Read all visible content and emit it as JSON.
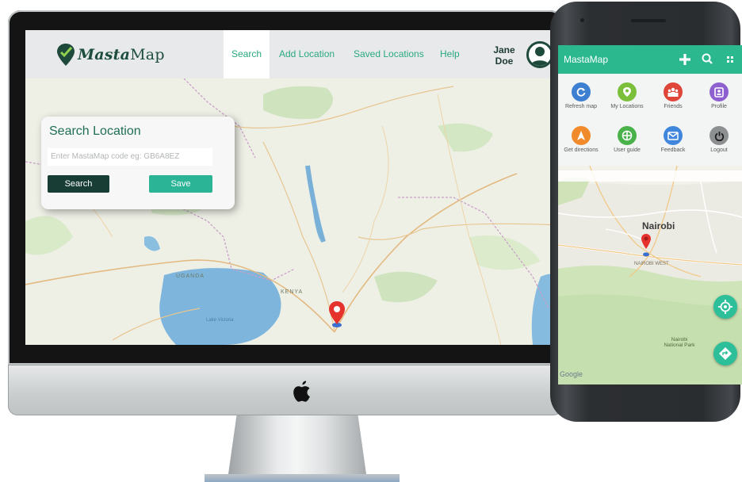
{
  "website": {
    "brand": {
      "prefix": "Masta",
      "suffix": "Map"
    },
    "nav": [
      {
        "label": "Search",
        "active": true
      },
      {
        "label": "Add Location",
        "active": false
      },
      {
        "label": "Saved Locations",
        "active": false
      },
      {
        "label": "Help",
        "active": false
      }
    ],
    "user": {
      "first": "Jane",
      "last": "Doe"
    },
    "search_panel": {
      "title": "Search Location",
      "placeholder": "Enter MastaMap code eg: GB6A8EZ",
      "search_button": "Search",
      "save_button": "Save"
    },
    "map_labels": [
      "UGANDA",
      "KENYA",
      "Lake Victoria"
    ]
  },
  "phone": {
    "app_title": "MastaMap",
    "menu": [
      {
        "label": "Refresh map",
        "icon": "refresh-icon",
        "color": "#3d7fd1"
      },
      {
        "label": "My Locations",
        "icon": "location-pin-icon",
        "color": "#7cbf3b"
      },
      {
        "label": "Friends",
        "icon": "friends-icon",
        "color": "#e0453a"
      },
      {
        "label": "Profile",
        "icon": "profile-icon",
        "color": "#8e5fcf"
      },
      {
        "label": "Get directions",
        "icon": "directions-icon",
        "color": "#f08a2a"
      },
      {
        "label": "User guide",
        "icon": "user-guide-icon",
        "color": "#49b24a"
      },
      {
        "label": "Feedback",
        "icon": "feedback-icon",
        "color": "#3f86dc"
      },
      {
        "label": "Logout",
        "icon": "power-icon",
        "color": "#8d9091"
      }
    ],
    "map": {
      "city": "Nairobi",
      "area": "NAIROBI WEST",
      "park": "Nairobi National Park",
      "attribution": "Google"
    }
  },
  "colors": {
    "accent": "#2aa980",
    "dark_green": "#173d34",
    "app_bar": "#2cb88e"
  }
}
